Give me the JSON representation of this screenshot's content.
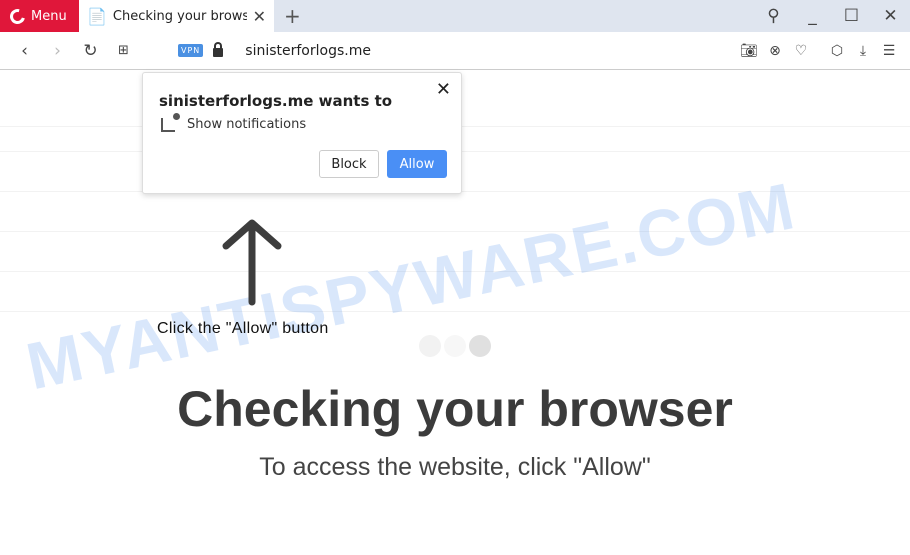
{
  "browser": {
    "menu_label": "Menu",
    "tab_title": "Checking your browser",
    "vpn_badge": "VPN",
    "url": "sinisterforlogs.me"
  },
  "popup": {
    "title": "sinisterforlogs.me wants to",
    "permission": "Show notifications",
    "block_label": "Block",
    "allow_label": "Allow"
  },
  "page": {
    "instruction": "Click the \"Allow\" button",
    "heading": "Checking your browser",
    "subheading": "To access the website, click \"Allow\""
  },
  "watermark": "MYANTISPYWARE.COM",
  "colors": {
    "menu": "#e0173a",
    "allow": "#4a8ff5",
    "vpn": "#4a90e2"
  }
}
